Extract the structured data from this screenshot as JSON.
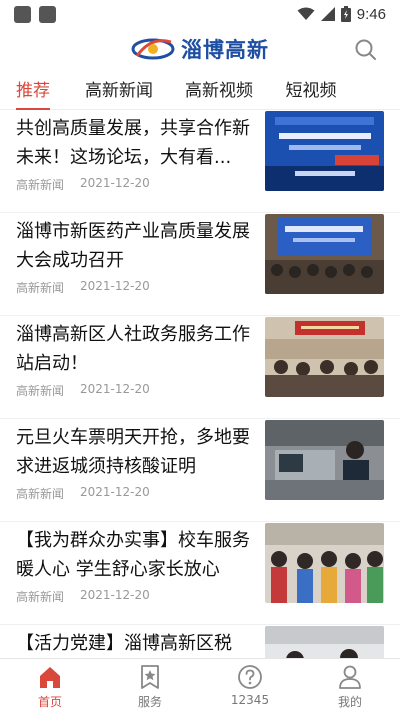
{
  "status_bar": {
    "time": "9:46"
  },
  "app": {
    "logo_text": "淄博高新"
  },
  "tabs": [
    {
      "label": "推荐",
      "active": true
    },
    {
      "label": "高新新闻",
      "active": false
    },
    {
      "label": "高新视频",
      "active": false
    },
    {
      "label": "短视频",
      "active": false
    }
  ],
  "feed": [
    {
      "title": "共创高质量发展，共享合作新未来！这场论坛，大有看...",
      "source": "高新新闻",
      "date": "2021-12-20"
    },
    {
      "title": "淄博市新医药产业高质量发展大会成功召开",
      "source": "高新新闻",
      "date": "2021-12-20"
    },
    {
      "title": "淄博高新区人社政务服务工作站启动！",
      "source": "高新新闻",
      "date": "2021-12-20"
    },
    {
      "title": "元旦火车票明天开抢，多地要求进返城须持核酸证明",
      "source": "高新新闻",
      "date": "2021-12-20"
    },
    {
      "title": "【我为群众办实事】校车服务暖人心 学生舒心家长放心",
      "source": "高新新闻",
      "date": "2021-12-20"
    },
    {
      "title": "【活力党建】淄博高新区税",
      "source": "",
      "date": ""
    }
  ],
  "bottom_nav": [
    {
      "label": "首页",
      "icon": "home-icon",
      "active": true
    },
    {
      "label": "服务",
      "icon": "star-bookmark-icon",
      "active": false
    },
    {
      "label": "12345",
      "icon": "question-icon",
      "active": false
    },
    {
      "label": "我的",
      "icon": "person-icon",
      "active": false
    }
  ],
  "colors": {
    "accent": "#d9483b",
    "brand": "#1f4fa3",
    "meta": "#999999"
  }
}
